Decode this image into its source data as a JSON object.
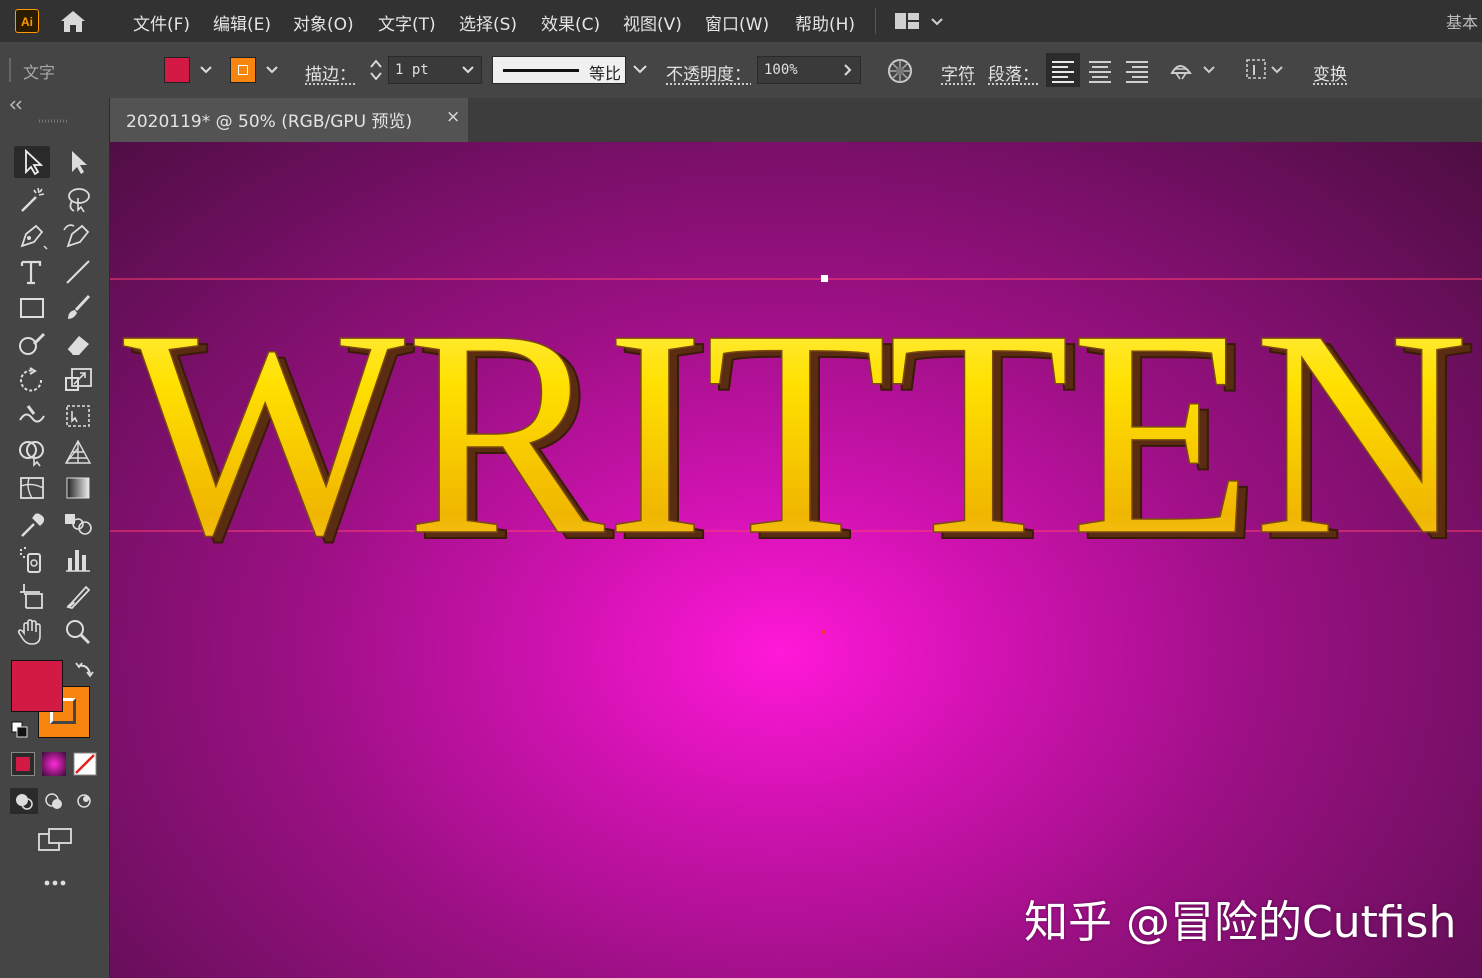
{
  "app": {
    "logo_text": "Ai",
    "workspace_label": "基本",
    "menu": [
      "文件(F)",
      "编辑(E)",
      "对象(O)",
      "文字(T)",
      "选择(S)",
      "效果(C)",
      "视图(V)",
      "窗口(W)",
      "帮助(H)"
    ]
  },
  "control_bar": {
    "tool_label": "文字",
    "fill_color": "#d31a45",
    "stroke_color": "#f7850f",
    "stroke_label": "描边：",
    "stroke_weight": "1 pt",
    "stroke_profile_label": "等比",
    "opacity_label": "不透明度：",
    "opacity_value": "100%",
    "character_label": "字符",
    "paragraph_label": "段落：",
    "transform_label": "变换"
  },
  "document": {
    "tab_title": "2020119* @ 50% (RGB/GPU 预览)",
    "close_glyph": "×"
  },
  "canvas": {
    "headline_text": "WRITTEN",
    "gradient_center": "#ff18d8",
    "gradient_edge": "#3d0d33",
    "text_gold": "#ffd800",
    "guide_color": "#ff3f6d",
    "watermark": "知乎 @冒险的Cutfish"
  },
  "tool_colors": {
    "fill": "#d31a45",
    "stroke": "#f7850f"
  }
}
